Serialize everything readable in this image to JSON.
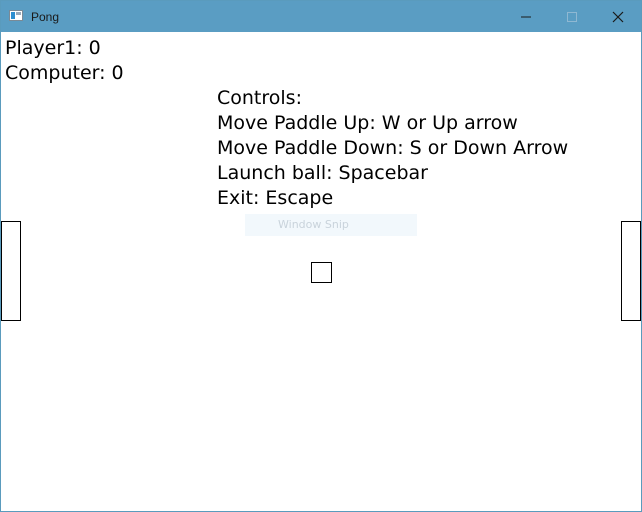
{
  "window": {
    "title": "Pong"
  },
  "titlebar_buttons": {
    "minimize": "minimize-icon",
    "maximize": "maximize-icon",
    "close": "close-icon"
  },
  "scores": {
    "player": "Player1: 0",
    "computer": "Computer: 0"
  },
  "controls": {
    "heading": "Controls:",
    "lines": [
      "Move Paddle Up: W or Up arrow",
      "Move Paddle Down: S or Down Arrow",
      "Launch ball: Spacebar",
      "Exit: Escape"
    ]
  },
  "overlay": {
    "snip_label": "Window Snip"
  },
  "colors": {
    "titlebar": "#5a9dc3",
    "background": "#ffffff",
    "outline": "#000000"
  }
}
